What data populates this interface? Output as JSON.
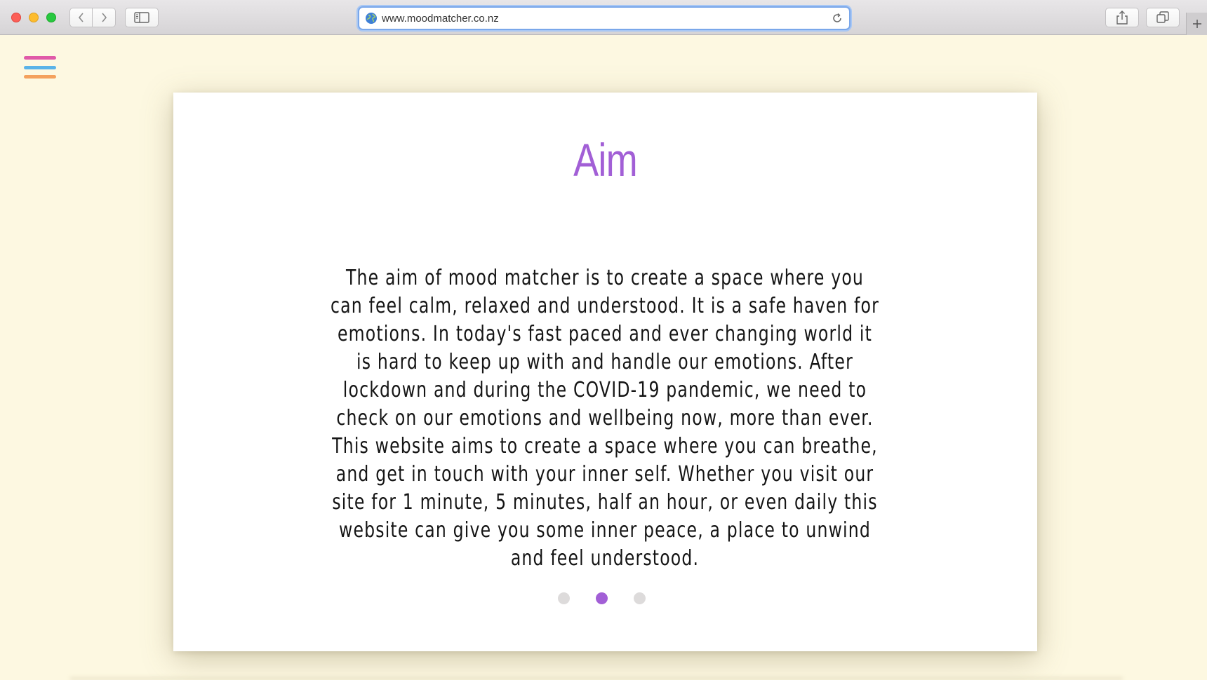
{
  "browser": {
    "url": "www.moodmatcher.co.nz"
  },
  "page": {
    "title": "Aim",
    "body": "The aim of mood matcher is to create a space where you can feel calm, relaxed and understood. It is a safe haven for emotions. In today's fast paced and ever changing world it is hard to keep up with and handle our emotions. After lockdown and during the COVID-19 pandemic, we need to check on our emotions and wellbeing now, more than ever. This website aims to create a space where you can breathe, and get in touch with your inner self. Whether you visit our site for 1 minute, 5 minutes, half an hour, or even daily this website can give you some inner peace, a place to unwind and feel understood.",
    "slides": {
      "count": 3,
      "active": 2
    }
  },
  "colors": {
    "background": "#fdf8e1",
    "title": "#a25fd6",
    "menu_line_1": "#e05aa8",
    "menu_line_2": "#5bb3e8",
    "menu_line_3": "#f4a15d",
    "dot_active": "#a25fd6",
    "dot_inactive": "#dddbdb"
  },
  "icons": {
    "back": "chevron-left-icon",
    "forward": "chevron-right-icon",
    "sidebar": "sidebar-icon",
    "site": "globe-icon",
    "reload": "reload-icon",
    "share": "share-icon",
    "tabs": "tabs-icon",
    "new_tab": "plus-icon",
    "menu": "hamburger-menu-icon"
  }
}
